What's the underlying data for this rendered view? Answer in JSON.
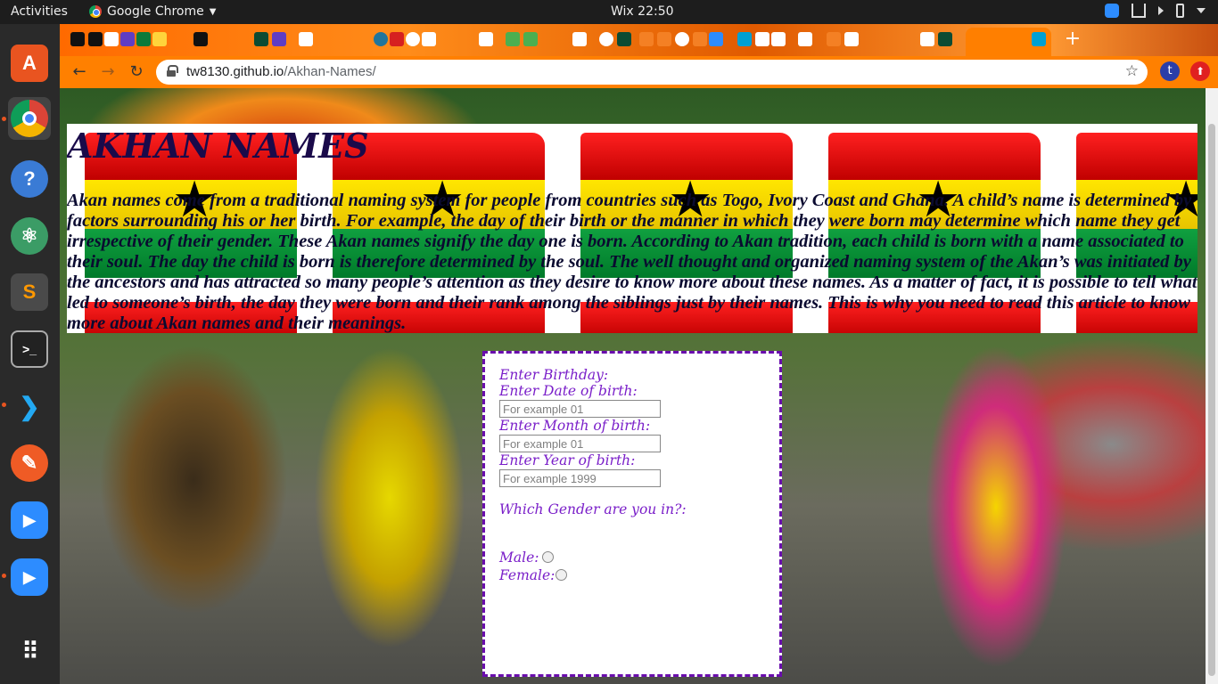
{
  "topbar": {
    "activities": "Activities",
    "app_name": "Google Chrome",
    "clock": "Wix 22:50"
  },
  "browser": {
    "url_host": "tw8130.github.io",
    "url_path": "/Akhan-Names/",
    "profile_initial": "t",
    "new_tab": "+",
    "tab_close": "✕"
  },
  "page": {
    "title": "AKHAN NAMES",
    "intro": "Akan names come from a traditional naming system for people from countries such as Togo, Ivory Coast and Ghana. A child’s name is determined by factors surrounding his or her birth. For example, the day of their birth or the manner in which they were born may determine which name they get irrespective of their gender. These Akan names signify the day one is born. According to Akan tradition, each child is born with a name associated to their soul. The day the child is born is therefore determined by the soul. The well thought and organized naming system of the Akan’s was initiated by the ancestors and has attracted so many people’s attention as they desire to know more about these names. As a matter of fact, it is possible to tell what led to someone’s birth, the day they were born and their rank among the siblings just by their names. This is why you need to read this article to know more about Akan names and their meanings."
  },
  "form": {
    "heading": "Enter Birthday:",
    "date_label": "Enter Date of birth:",
    "date_placeholder": "For example 01",
    "month_label": "Enter Month of birth:",
    "month_placeholder": "For example 01",
    "year_label": "Enter Year of birth:",
    "year_placeholder": "For example 1999",
    "gender_label": "Which Gender are you in?:",
    "male_label": "Male:",
    "female_label": "Female:"
  },
  "colors": {
    "form_text": "#7a1fc9",
    "form_border": "#6a0dad",
    "browser_theme": "#ff8000",
    "title_color": "#1a0a4a"
  }
}
